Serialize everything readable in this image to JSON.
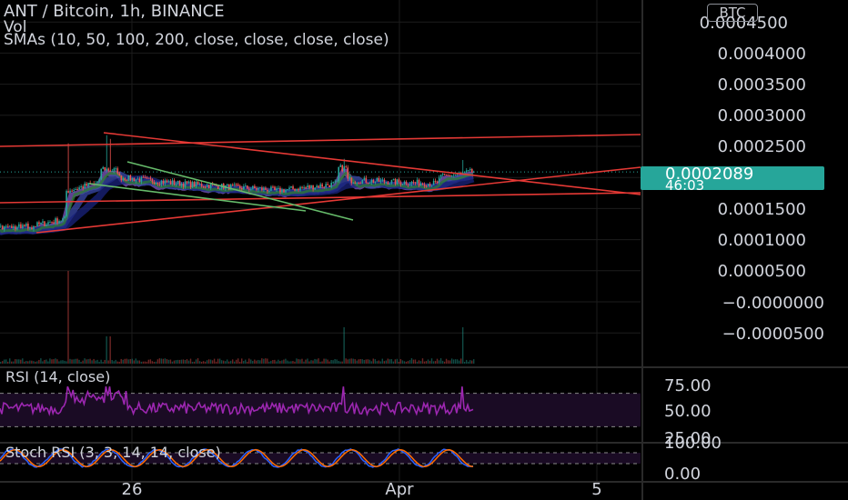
{
  "header": {
    "symbol_line": "ANT / Bitcoin, 1h, BINANCE",
    "vol_label": "Vol",
    "sma_label": "SMAs (10, 50, 100, 200, close, close, close, close)",
    "currency_button": "BTC"
  },
  "price_axis": {
    "ticks": [
      "0.0004500",
      "0.0004000",
      "0.0003500",
      "0.0003000",
      "0.0002500",
      "0.0001500",
      "0.0001000",
      "0.0000500",
      "−0.0000000",
      "−0.0000500"
    ],
    "tick_values": [
      0.00045,
      0.0004,
      0.00035,
      0.0003,
      0.00025,
      0.00015,
      0.0001,
      5e-05,
      0,
      -5e-05
    ],
    "current_price": "0.0002089",
    "countdown": "46:03"
  },
  "rsi_panel": {
    "label": "RSI (14, close)",
    "ticks": [
      "75.00",
      "50.00",
      "25.00"
    ],
    "tick_values": [
      75,
      50,
      25
    ]
  },
  "stoch_panel": {
    "label": "Stoch RSI (3, 3, 14, 14, close)",
    "ticks": [
      "100.00",
      "0.00"
    ],
    "tick_values": [
      100,
      0
    ]
  },
  "time_axis": {
    "labels": [
      "26",
      "Apr",
      "5"
    ]
  },
  "colors": {
    "background": "#000000",
    "up_candle": "#26a69a",
    "down_candle": "#ef5350",
    "trendline_red": "#e53935",
    "trendline_green": "#66bb6a",
    "rsi_line": "#9c27b0",
    "stoch_k": "#2962ff",
    "stoch_d": "#ff6d00",
    "price_tag": "#26a69a"
  }
}
